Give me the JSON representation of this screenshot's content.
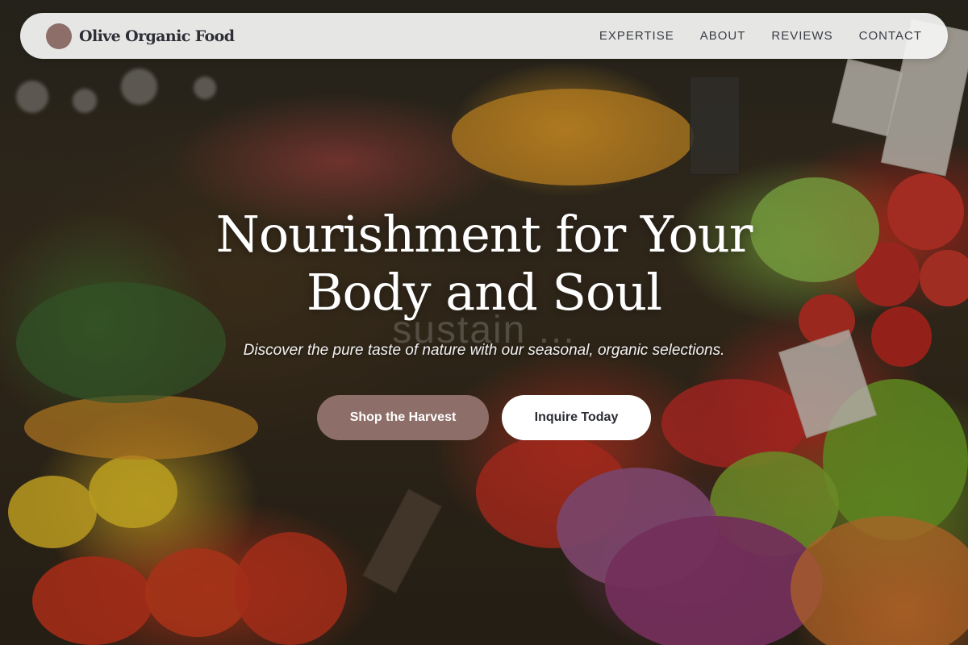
{
  "brand": {
    "name": "Olive Organic Food",
    "logo_color": "#8d6e68"
  },
  "nav": {
    "items": [
      {
        "label": "EXPERTISE"
      },
      {
        "label": "ABOUT"
      },
      {
        "label": "REVIEWS"
      },
      {
        "label": "CONTACT"
      }
    ]
  },
  "hero": {
    "headline_line1": "Nourishment for Your",
    "headline_line2": "Body and Soul",
    "ghost_text": "sustain ...",
    "subtitle": "Discover the pure taste of nature with our seasonal, organic selections.",
    "primary_cta": "Shop the Harvest",
    "secondary_cta": "Inquire Today"
  },
  "colors": {
    "accent": "#8d6e68",
    "nav_background": "#f5f5f5",
    "text_dark": "#2e2f36"
  }
}
